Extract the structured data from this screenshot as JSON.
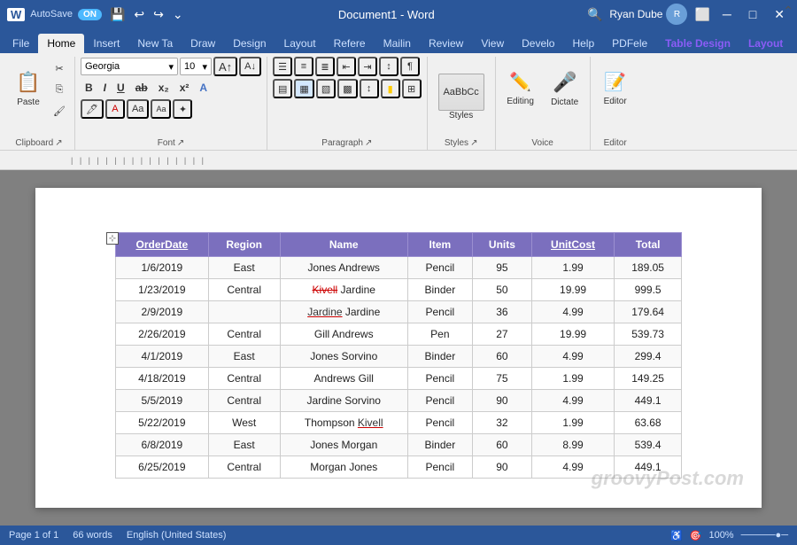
{
  "titlebar": {
    "autosave_label": "AutoSave",
    "toggle_state": "ON",
    "doc_title": "Document1 - Word",
    "user_name": "Ryan Dube",
    "search_placeholder": "Search"
  },
  "ribbon_tabs": [
    {
      "id": "file",
      "label": "File",
      "active": false
    },
    {
      "id": "home",
      "label": "Home",
      "active": true
    },
    {
      "id": "insert",
      "label": "Insert",
      "active": false
    },
    {
      "id": "new-tab",
      "label": "New Ta",
      "active": false
    },
    {
      "id": "draw",
      "label": "Draw",
      "active": false
    },
    {
      "id": "design",
      "label": "Desig",
      "active": false
    },
    {
      "id": "layout",
      "label": "Layout",
      "active": false
    },
    {
      "id": "references",
      "label": "Refere",
      "active": false
    },
    {
      "id": "mailings",
      "label": "Mailin",
      "active": false
    },
    {
      "id": "review",
      "label": "Review",
      "active": false
    },
    {
      "id": "view",
      "label": "View",
      "active": false
    },
    {
      "id": "developer",
      "label": "Develo",
      "active": false
    },
    {
      "id": "help",
      "label": "Help",
      "active": false
    },
    {
      "id": "pdfele",
      "label": "PDFele",
      "active": false
    },
    {
      "id": "table-design",
      "label": "Table Design",
      "active": false,
      "special": true
    },
    {
      "id": "layout2",
      "label": "Layout",
      "active": false,
      "special": true
    }
  ],
  "ribbon": {
    "groups": [
      {
        "id": "clipboard",
        "label": "Clipboard"
      },
      {
        "id": "font",
        "label": "Font"
      },
      {
        "id": "paragraph",
        "label": "Paragraph"
      },
      {
        "id": "styles",
        "label": "Styles"
      },
      {
        "id": "voice",
        "label": "Voice"
      },
      {
        "id": "editor",
        "label": "Editor"
      }
    ],
    "paste_label": "Paste",
    "font_name": "Georgia",
    "font_size": "10",
    "styles_label": "Styles",
    "editing_label": "Editing",
    "dictate_label": "Dictate",
    "editor_label": "Editor"
  },
  "table": {
    "headers": [
      "OrderDate",
      "Region",
      "Name",
      "Item",
      "Units",
      "UnitCost",
      "Total"
    ],
    "header_underlines": [
      true,
      false,
      false,
      false,
      false,
      true,
      false
    ],
    "rows": [
      [
        "1/6/2019",
        "East",
        "Jones Andrews",
        "Pencil",
        "95",
        "1.99",
        "189.05"
      ],
      [
        "1/23/2019",
        "Central",
        "Kivell Jardine",
        "Binder",
        "50",
        "19.99",
        "999.5"
      ],
      [
        "2/9/2019",
        "",
        "Jardine Jardine",
        "Pencil",
        "36",
        "4.99",
        "179.64"
      ],
      [
        "2/26/2019",
        "Central",
        "Gill Andrews",
        "Pen",
        "27",
        "19.99",
        "539.73"
      ],
      [
        "4/1/2019",
        "East",
        "Jones Sorvino",
        "Binder",
        "60",
        "4.99",
        "299.4"
      ],
      [
        "4/18/2019",
        "Central",
        "Andrews Gill",
        "Pencil",
        "75",
        "1.99",
        "149.25"
      ],
      [
        "5/5/2019",
        "Central",
        "Jardine Sorvino",
        "Pencil",
        "90",
        "4.99",
        "449.1"
      ],
      [
        "5/22/2019",
        "West",
        "Thompson Kivell",
        "Pencil",
        "32",
        "1.99",
        "63.68"
      ],
      [
        "6/8/2019",
        "East",
        "Jones Morgan",
        "Binder",
        "60",
        "8.99",
        "539.4"
      ],
      [
        "6/25/2019",
        "Central",
        "Morgan Jones",
        "Pencil",
        "90",
        "4.99",
        "449.1"
      ]
    ],
    "special_cells": {
      "1_2_strikethrough": true,
      "2_2_underline": true,
      "7_2_underline": true
    }
  },
  "statusbar": {
    "page_info": "Page 1 of 1",
    "words": "66 words",
    "lang": "English (United States)",
    "zoom": "100%"
  },
  "watermark": "groovyPost.com"
}
